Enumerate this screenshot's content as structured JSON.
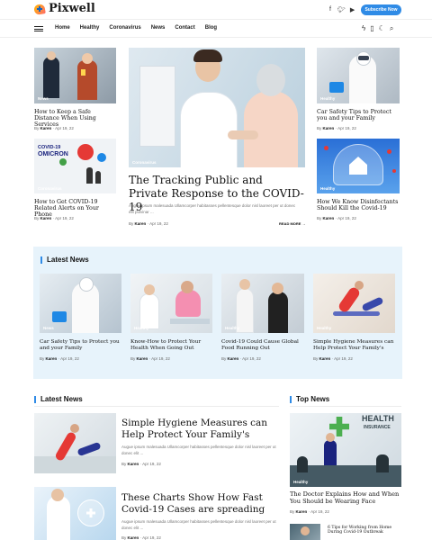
{
  "header": {
    "logo_text": "Pixwell",
    "socials": [
      "f",
      "t",
      "yt"
    ],
    "subscribe_label": "Subscribe Now"
  },
  "nav": {
    "items": [
      "Home",
      "Healthy",
      "Coronavirus",
      "News",
      "Contact",
      "Blog"
    ]
  },
  "featured": {
    "left": [
      {
        "tag": "News",
        "title": "How to Keep a Safe Distance When Using Services",
        "meta_by": "By",
        "author": "Karen",
        "date": "Apr 19, 22"
      },
      {
        "tag": "Coronavirus",
        "title": "How to Get COVID-19 Related Alerts on Your Phone",
        "meta_by": "By",
        "author": "Karen",
        "date": "Apr 19, 22"
      }
    ],
    "center": {
      "tag": "Coronavirus",
      "title": "The Tracking Public and Private Response to the COVID-19",
      "excerpt": "Augue ipsum malesuada Ullamcorper habitasses pellentesque dolor nisl laoreet per ut donec elit pulvinar ...",
      "meta_by": "By",
      "author": "Karen",
      "date": "Apr 19, 22",
      "read_more": "READ MORE →"
    },
    "right": [
      {
        "tag": "Healthy",
        "title": "Car Safety Tips to Protect you and your Family",
        "meta_by": "By",
        "author": "Karen",
        "date": "Apr 19, 22"
      },
      {
        "tag": "Healthy",
        "title": "How We Know Disinfectants Should Kill the Covid-19",
        "meta_by": "By",
        "author": "Karen",
        "date": "Apr 19, 22"
      }
    ],
    "omicron_text": {
      "line1": "COVID-19",
      "line2": "OMICRON"
    }
  },
  "latest_band": {
    "title": "Latest News",
    "cards": [
      {
        "tag": "News",
        "title": "Car Safety Tips to Protect you and your Family",
        "meta_by": "By",
        "author": "Karen",
        "date": "Apr 19, 22"
      },
      {
        "tag": "Healthy",
        "title": "Know-How to Protect Your Health When Going Out",
        "meta_by": "By",
        "author": "Karen",
        "date": "Apr 19, 22"
      },
      {
        "tag": "Healthy",
        "title": "Covid-19 Could Cause Global Food Running Out",
        "meta_by": "By",
        "author": "Karen",
        "date": "Apr 19, 22"
      },
      {
        "tag": "Healthy",
        "title": "Simple Hygiene Measures can Help Protect Your Family's",
        "meta_by": "By",
        "author": "Karen",
        "date": "Apr 19, 22"
      }
    ]
  },
  "latest_list": {
    "title": "Latest News",
    "items": [
      {
        "title": "Simple Hygiene Measures can Help Protect Your Family's",
        "excerpt": "Augue ipsum malesuada Ullamcorper habitasses pellentesque dolor nisl laoreet per ut donec elit ...",
        "meta_by": "By",
        "author": "Karen",
        "date": "Apr 19, 22"
      },
      {
        "title": "These Charts Show How Fast Covid-19 Cases are spreading",
        "excerpt": "Augue ipsum malesuada Ullamcorper habitasses pellentesque dolor nisl laoreet per ut donec elit ...",
        "meta_by": "By",
        "author": "Karen",
        "date": "Apr 19, 22"
      }
    ]
  },
  "top_news": {
    "title": "Top News",
    "main": {
      "tag": "Healthy",
      "title": "The Doctor Explains How and When You Should be Wearing Face",
      "meta_by": "By",
      "author": "Karen",
      "date": "Apr 19, 22",
      "image_text": {
        "line1": "HEALTH",
        "line2": "INSURANCE"
      }
    },
    "small": {
      "title": "6 Tips for Working from Home During Covid-19 Outbreak"
    }
  }
}
